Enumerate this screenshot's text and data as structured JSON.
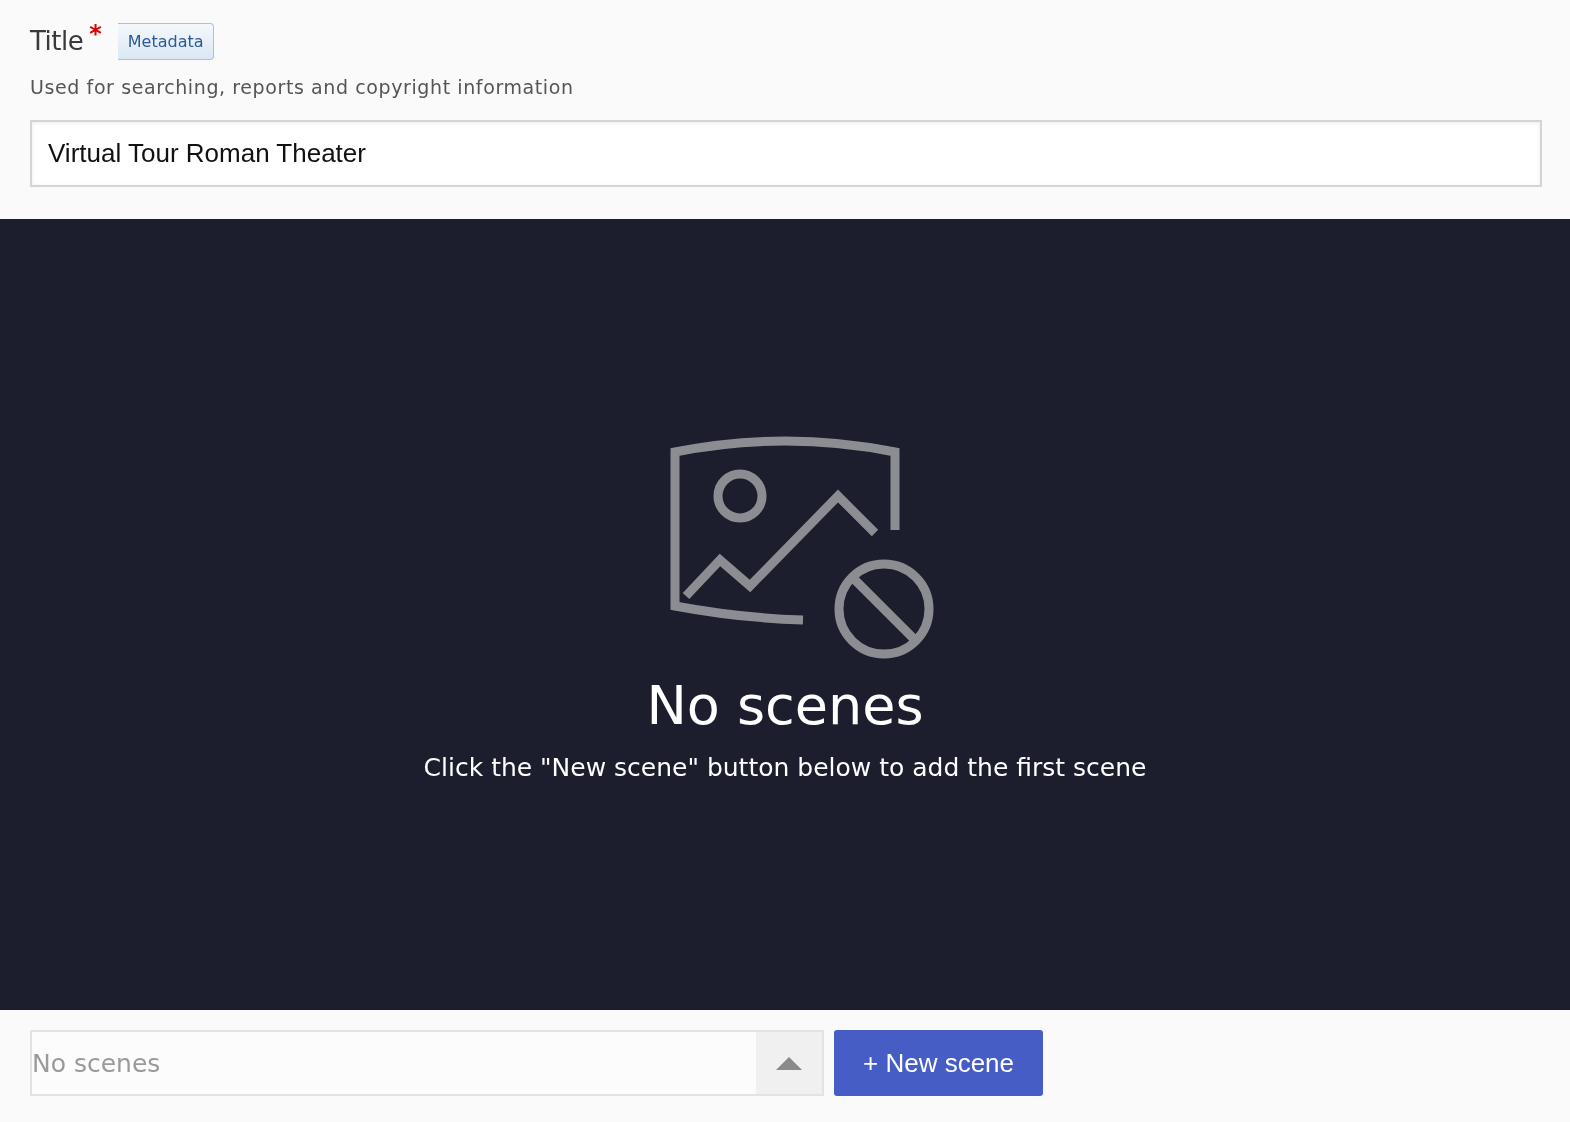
{
  "title_field": {
    "label": "Title",
    "required_mark": "*",
    "tag": "Metadata",
    "description": "Used for searching, reports and copyright information",
    "value": "Virtual Tour Roman Theater"
  },
  "preview": {
    "heading": "No scenes",
    "message": "Click the \"New scene\" button below to add the first scene"
  },
  "scene_select": {
    "placeholder": "No scenes"
  },
  "new_scene_button": "+ New scene"
}
